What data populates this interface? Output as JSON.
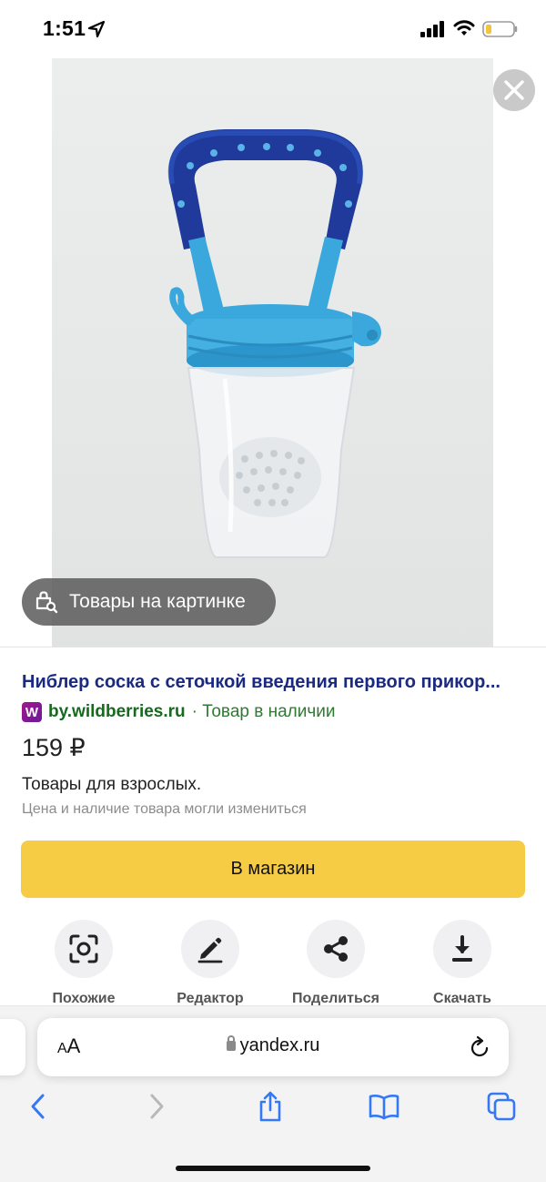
{
  "status_bar": {
    "time": "1:51"
  },
  "image_viewer": {
    "lens_label": "Товары на картинке"
  },
  "product": {
    "title": "Ниблер соска с сеточкой введения первого прикор...",
    "source_logo_letter": "W",
    "source_domain": "by.wildberries.ru",
    "availability": "· Товар в наличии",
    "price": "159 ₽",
    "category": "Товары для взрослых.",
    "disclaimer": "Цена и наличие товара могли измениться",
    "shop_button": "В магазин"
  },
  "actions": [
    {
      "label": "Похожие",
      "icon": "similar-scan-icon"
    },
    {
      "label": "Редактор",
      "icon": "pencil-icon"
    },
    {
      "label": "Поделиться",
      "icon": "share-icon"
    },
    {
      "label": "Скачать",
      "icon": "download-icon"
    }
  ],
  "browser": {
    "aa_label": "AA",
    "url": "yandex.ru"
  },
  "colors": {
    "title_link": "#1a2a80",
    "source_green": "#156b1d",
    "shop_button_bg": "#f6cc44",
    "safari_blue": "#3478f6"
  }
}
